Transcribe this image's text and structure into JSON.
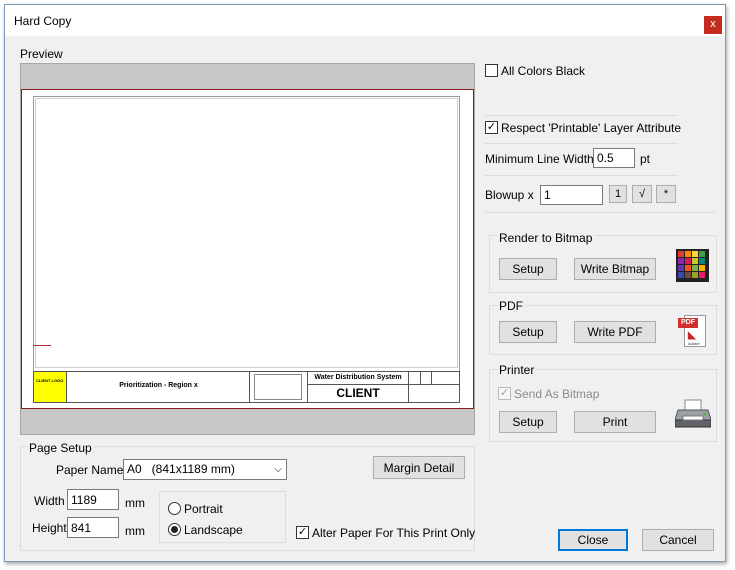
{
  "window": {
    "title": "Hard Copy",
    "close_glyph": "x"
  },
  "preview": {
    "label": "Preview",
    "title_block": {
      "logo_text": "CLIENT LOGO",
      "drawing_title": "Prioritization - Region x",
      "system_name": "Water Distribution System",
      "client": "CLIENT"
    }
  },
  "options": {
    "all_colors_black": {
      "label": "All Colors Black",
      "checked": false
    },
    "respect_printable": {
      "label": "Respect 'Printable' Layer Attribute",
      "checked": true
    },
    "min_line_width": {
      "label": "Minimum Line Width",
      "value": "0.5",
      "unit": "pt"
    },
    "blowup": {
      "label": "Blowup  x",
      "value": "1",
      "btn_one": "1",
      "btn_sqrt": "√",
      "btn_star": "*"
    }
  },
  "render_bitmap": {
    "title": "Render to Bitmap",
    "setup_label": "Setup",
    "write_label": "Write Bitmap",
    "icon": "palette-icon"
  },
  "pdf": {
    "title": "PDF",
    "setup_label": "Setup",
    "write_label": "Write PDF",
    "icon": "pdf-icon",
    "icon_text": "PDF",
    "icon_subtext": "Adobe"
  },
  "printer": {
    "title": "Printer",
    "send_as_bitmap": {
      "label": "Send As Bitmap",
      "checked": true,
      "disabled": true
    },
    "setup_label": "Setup",
    "print_label": "Print",
    "icon": "printer-icon"
  },
  "page_setup": {
    "title": "Page Setup",
    "paper_name_label": "Paper Name",
    "paper_name_value": "A0   (841x1189 mm)",
    "margin_label": "Margin Detail",
    "width_label": "Width",
    "width_value": "1189",
    "height_label": "Height",
    "height_value": "841",
    "unit": "mm",
    "orientation": {
      "portrait_label": "Portrait",
      "landscape_label": "Landscape",
      "selected": "landscape"
    },
    "alter_paper": {
      "label": "Alter Paper For This Print Only",
      "checked": true
    }
  },
  "footer": {
    "close_label": "Close",
    "cancel_label": "Cancel"
  },
  "colors": {
    "accent": "#0078d7",
    "close_red": "#c42b1c",
    "preview_gray": "#c8c8c8",
    "sheet_border": "#8b1a1a",
    "logo_yellow": "#ffff00"
  }
}
